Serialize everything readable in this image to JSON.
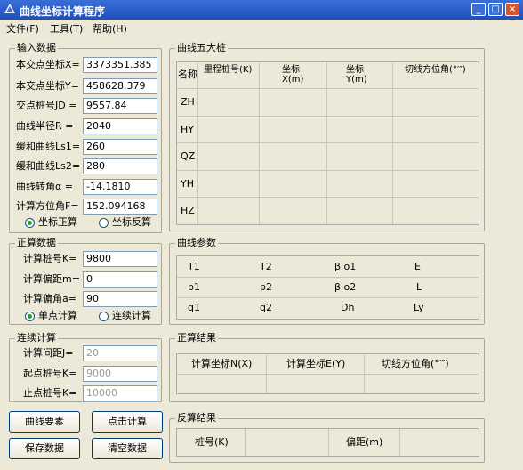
{
  "title": "曲线坐标计算程序",
  "menu": [
    "文件(F)",
    "工具(T)",
    "帮助(H)"
  ],
  "window_buttons": {
    "minimize": "_",
    "maximize": "□",
    "close": "×"
  },
  "input": {
    "title": "输入数据",
    "rows": [
      {
        "label": "本交点坐标X=",
        "value": "3373351.385"
      },
      {
        "label": "本交点坐标Y=",
        "value": "458628.379"
      },
      {
        "label": "交点桩号JD =",
        "value": "9557.84"
      },
      {
        "label": "曲线半径R =",
        "value": "2040"
      },
      {
        "label": "缓和曲线Ls1=",
        "value": "260"
      },
      {
        "label": "缓和曲线Ls2=",
        "value": "280"
      },
      {
        "label": "曲线转角α =",
        "value": "-14.1810"
      },
      {
        "label": "计算方位角F=",
        "value": "152.094168"
      }
    ],
    "radio1": "坐标正算",
    "radio2": "坐标反算"
  },
  "forward": {
    "title": "正算数据",
    "rows": [
      {
        "label": "计算桩号K=",
        "value": "9800"
      },
      {
        "label": "计算偏距m=",
        "value": "0"
      },
      {
        "label": "计算偏角a=",
        "value": "90"
      }
    ],
    "radio1": "单点计算",
    "radio2": "连续计算"
  },
  "continuous": {
    "title": "连续计算",
    "rows": [
      {
        "label": "计算间距J=",
        "value": "20"
      },
      {
        "label": "起点桩号K=",
        "value": "9000"
      },
      {
        "label": "止点桩号K=",
        "value": "10000"
      }
    ]
  },
  "buttons": {
    "curve": "曲线要素",
    "calc": "点击计算",
    "save": "保存数据",
    "clear": "清空数据"
  },
  "five": {
    "title": "曲线五大桩",
    "headers": [
      "名称",
      "里程桩号(K)",
      "坐标X(m)",
      "坐标Y(m)",
      "切线方位角(°′″)"
    ],
    "rows": [
      "ZH",
      "HY",
      "QZ",
      "YH",
      "HZ"
    ]
  },
  "params": {
    "title": "曲线参数",
    "rows": [
      [
        "T1",
        "T2",
        "β o1",
        "E"
      ],
      [
        "p1",
        "p2",
        "β o2",
        "L"
      ],
      [
        "q1",
        "q2",
        "Dh",
        "Ly"
      ]
    ]
  },
  "fresult": {
    "title": "正算结果",
    "headers": [
      "计算坐标N(X)",
      "计算坐标E(Y)",
      "切线方位角(°′″)"
    ]
  },
  "rresult": {
    "title": "反算结果",
    "headers": [
      "桩号(K)",
      "偏距(m)"
    ]
  }
}
